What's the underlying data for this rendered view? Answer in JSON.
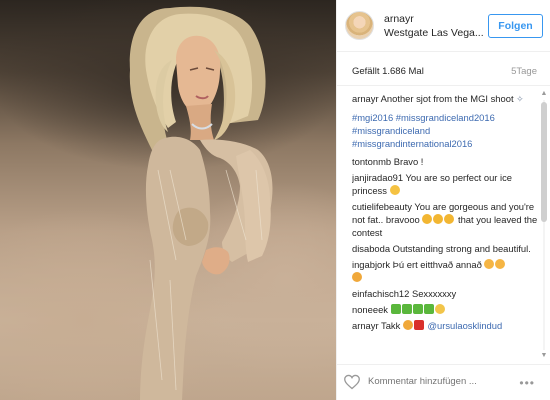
{
  "header": {
    "username": "arnayr",
    "location": "Westgate Las Vega...",
    "follow_label": "Folgen"
  },
  "stats": {
    "likes": "Gefällt 1.686 Mal",
    "time_ago": "5Tage"
  },
  "caption": {
    "user": "arnayr",
    "text": "Another sjot from the MGI shoot",
    "hashtags": [
      "#mgi2016 #missgrandiceland2016",
      "#missgrandiceland",
      "#missgrandinternational2016"
    ]
  },
  "comments": [
    {
      "user": "tontonmb",
      "text": "Bravo !"
    },
    {
      "user": "janjiradao91",
      "text": "You are so perfect our ice princess"
    },
    {
      "user": "cutielifebeauty",
      "text": "You are gorgeous and you're not fat.. bravooo",
      "text2": "that you leaved the contest"
    },
    {
      "user": "disaboda",
      "text": "Outstanding strong and beautiful."
    },
    {
      "user": "ingabjork",
      "text": "Þú ert eitthvað annað"
    },
    {
      "user": "einfachisch12",
      "text": "Sexxxxxxy"
    },
    {
      "user": "noneeek",
      "text": ""
    },
    {
      "user": "arnayr",
      "text": "Takk",
      "mention": "@ursulaosklindud"
    }
  ],
  "footer": {
    "placeholder": "Kommentar hinzufügen ...",
    "more_label": "•••"
  },
  "colors": {
    "link": "#3d6ab0",
    "follow": "#3897f0",
    "muted": "#999999"
  },
  "icons": [
    "heart-icon",
    "more-icon",
    "scroll-up-icon",
    "scroll-down-icon"
  ]
}
